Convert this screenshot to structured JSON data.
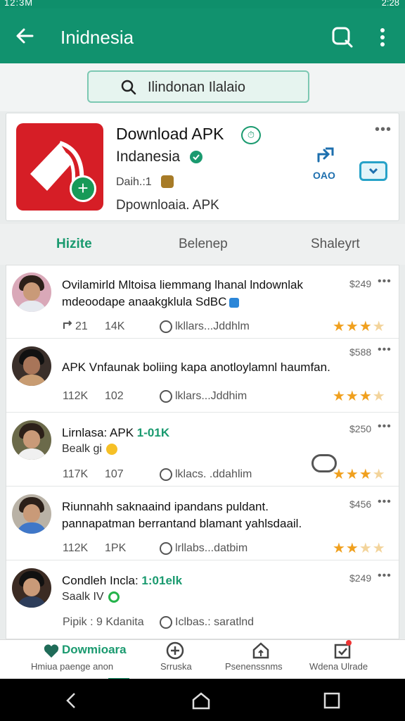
{
  "status_bar": {
    "left_text": "12:3M",
    "right_text": "2:28"
  },
  "appbar": {
    "title": "Inidnesia"
  },
  "search": {
    "text": "Ilindonan Ilalaio"
  },
  "app_card": {
    "title": "Download APK",
    "developer": "Indanesia",
    "daily": "Daih.:1",
    "downloads": "Dpownloaia. APK",
    "share_label": "OAO"
  },
  "tabs": [
    "Hizite",
    "Belenep",
    "Shaleyrt"
  ],
  "posts": [
    {
      "line1": "Ovilamirld Mltoisa liemmang lhanal lndownlak",
      "line2": "mdeoodape anaakgklula SdBC",
      "price": "$249",
      "stat1": "21",
      "stat2": "14K",
      "comment": "lkllars...Jddhlm",
      "rating": 3.5
    },
    {
      "line1": "APK Vnfaunak boliing kapa anotloylamnl haumfan.",
      "line2": "",
      "price": "$588",
      "stat1": "112K",
      "stat2": "102",
      "comment": "lklars...Jddhim",
      "rating": 3.5
    },
    {
      "line1": "Lirnlasa: APK",
      "line1_accent": "1-01K",
      "line2": "Bealk gi",
      "price": "$250",
      "stat1": "117K",
      "stat2": "107",
      "comment": "lklacs. .ddahlim",
      "rating": 3.5
    },
    {
      "line1": "Riunnahh saknaaind ipandans puldant.",
      "line2": "pannapatman berrantand blamant yahlsdaail.",
      "price": "$456",
      "stat1": "112K",
      "stat2": "1PK",
      "comment": "lrllabs...datbim",
      "rating": 2.5
    },
    {
      "line1": "Condleh Incla:",
      "line1_accent": "1:01elk",
      "line2": "Saalk IV",
      "price": "$249",
      "stat1": "Pipik : 9 Kdanita",
      "stat2": "",
      "comment": "Iclbas.: saratlnd",
      "rating": 0
    }
  ],
  "bottom_nav": {
    "active_label": "Dowmioara",
    "items": [
      "Hmiua paenge anon",
      "Srruska",
      "Psenenssnms",
      "Wdena Ulrade"
    ]
  },
  "colors": {
    "primary": "#11926e",
    "accent": "#1a9a6f",
    "star": "#f0a01e",
    "app_icon": "#d61e26"
  }
}
